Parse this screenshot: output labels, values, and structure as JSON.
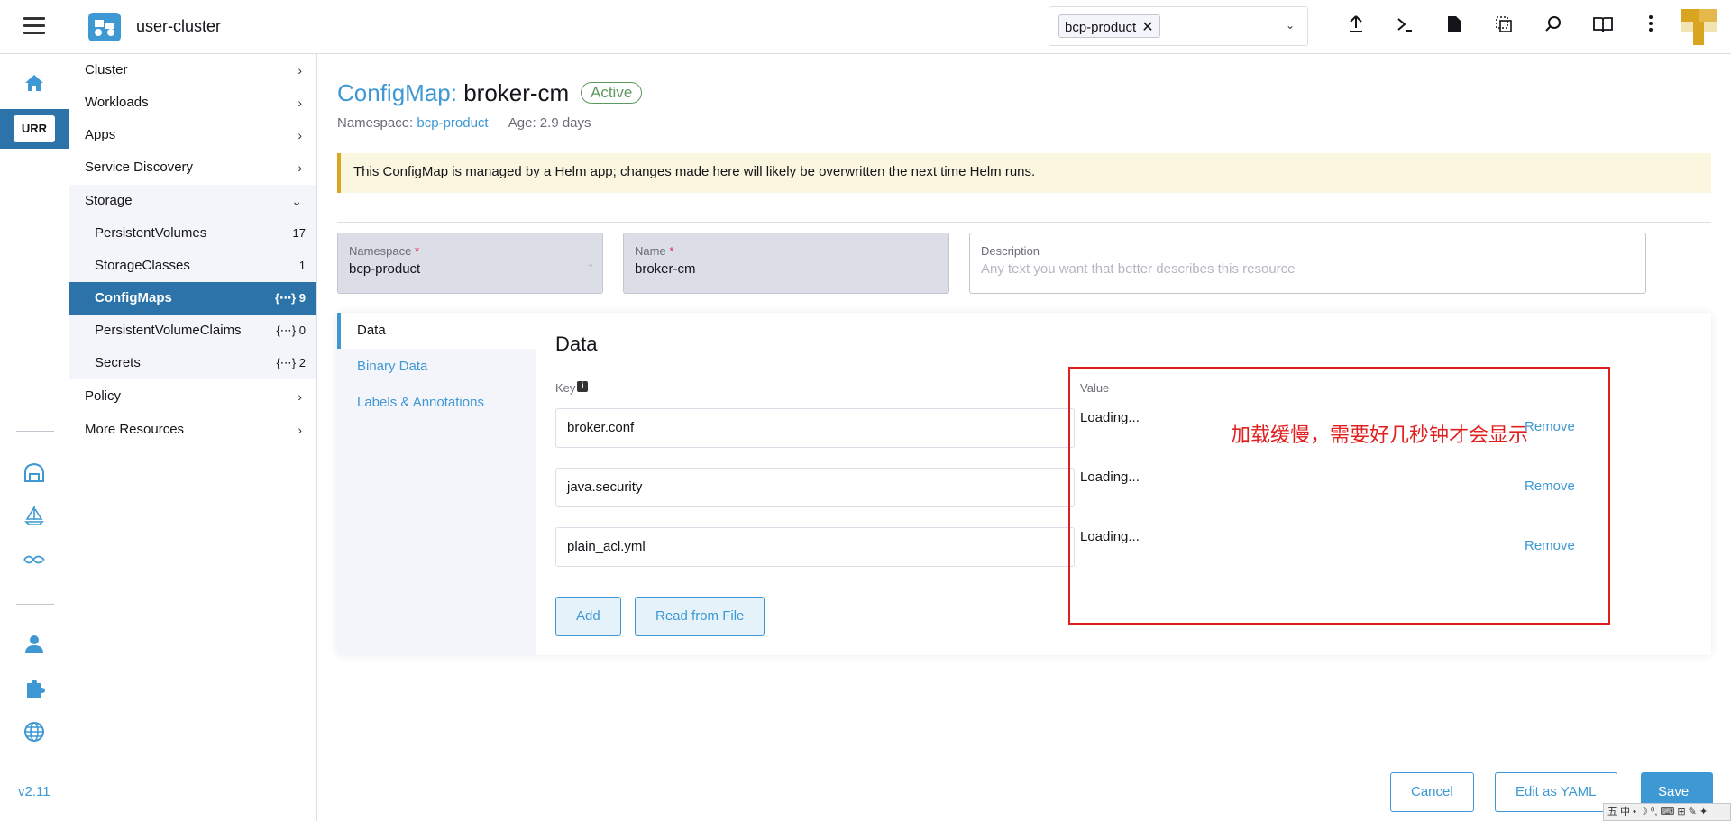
{
  "header": {
    "cluster_name": "user-cluster",
    "namespace_chip": "bcp-product",
    "chip_remove": "✕",
    "chevron": "⌄",
    "icons": [
      "upload-icon",
      "terminal-icon",
      "file-icon",
      "copy-config-icon",
      "search-icon",
      "book-icon",
      "more-vertical-icon"
    ]
  },
  "rail": {
    "active_cluster_label": "URR",
    "version": "v2.11"
  },
  "sidenav": {
    "items": [
      {
        "label": "Cluster",
        "chev": "›"
      },
      {
        "label": "Workloads",
        "chev": "›"
      },
      {
        "label": "Apps",
        "chev": "›"
      },
      {
        "label": "Service Discovery",
        "chev": "›"
      },
      {
        "label": "Storage",
        "chev": "⌄"
      }
    ],
    "storage_children": [
      {
        "label": "PersistentVolumes",
        "count": "17"
      },
      {
        "label": "StorageClasses",
        "count": "1"
      },
      {
        "label": "ConfigMaps",
        "count": "{⋯} 9"
      },
      {
        "label": "PersistentVolumeClaims",
        "count": "{⋯} 0"
      },
      {
        "label": "Secrets",
        "count": "{⋯} 2"
      }
    ],
    "bottom_items": [
      {
        "label": "Policy",
        "chev": "›"
      },
      {
        "label": "More Resources",
        "chev": "›"
      }
    ]
  },
  "page": {
    "kind": "ConfigMap:",
    "name": "broker-cm",
    "status": "Active",
    "namespace_label": "Namespace:",
    "namespace_value": "bcp-product",
    "age": "Age: 2.9 days",
    "banner": "This ConfigMap is managed by a Helm app; changes made here will likely be overwritten the next time Helm runs."
  },
  "form": {
    "namespace_label": "Namespace",
    "namespace_value": "bcp-product",
    "name_label": "Name",
    "name_value": "broker-cm",
    "required_mark": "*",
    "description_label": "Description",
    "description_placeholder": "Any text you want that better describes this resource"
  },
  "tabs": [
    "Data",
    "Binary Data",
    "Labels & Annotations"
  ],
  "data_section": {
    "heading": "Data",
    "key_label": "Key",
    "value_label": "Value",
    "rows": [
      {
        "key": "broker.conf",
        "value": "Loading...",
        "remove": "Remove"
      },
      {
        "key": "java.security",
        "value": "Loading...",
        "remove": "Remove"
      },
      {
        "key": "plain_acl.yml",
        "value": "Loading...",
        "remove": "Remove"
      }
    ],
    "add_label": "Add",
    "read_file_label": "Read from File"
  },
  "annotation": {
    "text": "加载缓慢，需要好几秒钟才会显示",
    "color": "#e02020"
  },
  "footer": {
    "cancel": "Cancel",
    "edit_yaml": "Edit as YAML",
    "save": "Save"
  },
  "ime_bar": "五 中 • ☽ ⁰, ⌨ ⊞ ✎ ✦",
  "colors": {
    "accent": "#3d98d3",
    "nav_active": "#2b73a8",
    "success": "#5d995d",
    "warning_bg": "#fbf6e0"
  }
}
